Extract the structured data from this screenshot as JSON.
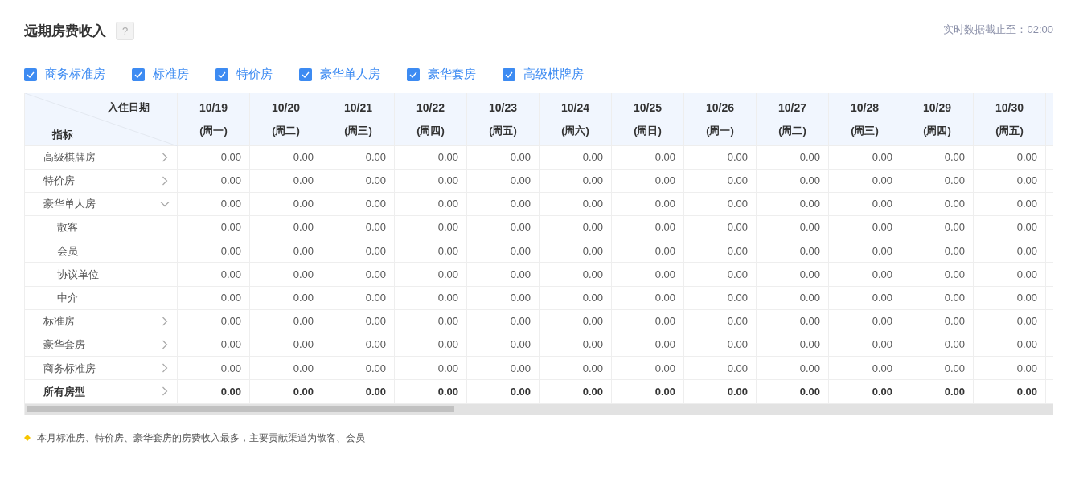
{
  "title": "远期房费收入",
  "help": "?",
  "updated": "实时数据截止至：02:00",
  "filters": [
    {
      "label": "商务标准房",
      "checked": true
    },
    {
      "label": "标准房",
      "checked": true
    },
    {
      "label": "特价房",
      "checked": true
    },
    {
      "label": "豪华单人房",
      "checked": true
    },
    {
      "label": "豪华套房",
      "checked": true
    },
    {
      "label": "高级棋牌房",
      "checked": true
    }
  ],
  "table": {
    "corner_top": "入住日期",
    "corner_bottom": "指标",
    "columns": [
      {
        "date": "10/19",
        "weekday": "(周一)"
      },
      {
        "date": "10/20",
        "weekday": "(周二)"
      },
      {
        "date": "10/21",
        "weekday": "(周三)"
      },
      {
        "date": "10/22",
        "weekday": "(周四)"
      },
      {
        "date": "10/23",
        "weekday": "(周五)"
      },
      {
        "date": "10/24",
        "weekday": "(周六)"
      },
      {
        "date": "10/25",
        "weekday": "(周日)"
      },
      {
        "date": "10/26",
        "weekday": "(周一)"
      },
      {
        "date": "10/27",
        "weekday": "(周二)"
      },
      {
        "date": "10/28",
        "weekday": "(周三)"
      },
      {
        "date": "10/29",
        "weekday": "(周四)"
      },
      {
        "date": "10/30",
        "weekday": "(周五)"
      }
    ],
    "rows": [
      {
        "label": "高级棋牌房",
        "kind": "room",
        "expanded": false,
        "values": [
          "0.00",
          "0.00",
          "0.00",
          "0.00",
          "0.00",
          "0.00",
          "0.00",
          "0.00",
          "0.00",
          "0.00",
          "0.00",
          "0.00"
        ]
      },
      {
        "label": "特价房",
        "kind": "room",
        "expanded": false,
        "values": [
          "0.00",
          "0.00",
          "0.00",
          "0.00",
          "0.00",
          "0.00",
          "0.00",
          "0.00",
          "0.00",
          "0.00",
          "0.00",
          "0.00"
        ]
      },
      {
        "label": "豪华单人房",
        "kind": "room",
        "expanded": true,
        "values": [
          "0.00",
          "0.00",
          "0.00",
          "0.00",
          "0.00",
          "0.00",
          "0.00",
          "0.00",
          "0.00",
          "0.00",
          "0.00",
          "0.00"
        ],
        "children": [
          {
            "label": "散客",
            "values": [
              "0.00",
              "0.00",
              "0.00",
              "0.00",
              "0.00",
              "0.00",
              "0.00",
              "0.00",
              "0.00",
              "0.00",
              "0.00",
              "0.00"
            ]
          },
          {
            "label": "会员",
            "values": [
              "0.00",
              "0.00",
              "0.00",
              "0.00",
              "0.00",
              "0.00",
              "0.00",
              "0.00",
              "0.00",
              "0.00",
              "0.00",
              "0.00"
            ]
          },
          {
            "label": "协议单位",
            "values": [
              "0.00",
              "0.00",
              "0.00",
              "0.00",
              "0.00",
              "0.00",
              "0.00",
              "0.00",
              "0.00",
              "0.00",
              "0.00",
              "0.00"
            ]
          },
          {
            "label": "中介",
            "values": [
              "0.00",
              "0.00",
              "0.00",
              "0.00",
              "0.00",
              "0.00",
              "0.00",
              "0.00",
              "0.00",
              "0.00",
              "0.00",
              "0.00"
            ]
          }
        ]
      },
      {
        "label": "标准房",
        "kind": "room",
        "expanded": false,
        "values": [
          "0.00",
          "0.00",
          "0.00",
          "0.00",
          "0.00",
          "0.00",
          "0.00",
          "0.00",
          "0.00",
          "0.00",
          "0.00",
          "0.00"
        ]
      },
      {
        "label": "豪华套房",
        "kind": "room",
        "expanded": false,
        "values": [
          "0.00",
          "0.00",
          "0.00",
          "0.00",
          "0.00",
          "0.00",
          "0.00",
          "0.00",
          "0.00",
          "0.00",
          "0.00",
          "0.00"
        ]
      },
      {
        "label": "商务标准房",
        "kind": "room",
        "expanded": false,
        "values": [
          "0.00",
          "0.00",
          "0.00",
          "0.00",
          "0.00",
          "0.00",
          "0.00",
          "0.00",
          "0.00",
          "0.00",
          "0.00",
          "0.00"
        ]
      },
      {
        "label": "所有房型",
        "kind": "total",
        "expanded": false,
        "values": [
          "0.00",
          "0.00",
          "0.00",
          "0.00",
          "0.00",
          "0.00",
          "0.00",
          "0.00",
          "0.00",
          "0.00",
          "0.00",
          "0.00"
        ]
      }
    ]
  },
  "note": "本月标准房、特价房、豪华套房的房费收入最多，主要贡献渠道为散客、会员"
}
